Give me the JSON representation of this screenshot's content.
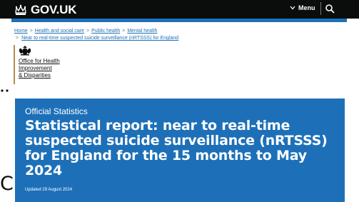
{
  "header": {
    "logo_text": "GOV.UK",
    "menu_label": "Menu",
    "colors": {
      "bar": "#0b0c0c",
      "accent": "#1d70b8"
    },
    "icons": [
      "crown-icon",
      "chevron-down-icon",
      "search-icon"
    ]
  },
  "breadcrumbs": {
    "items": [
      {
        "label": "Home"
      },
      {
        "label": "Health and social care"
      },
      {
        "label": "Public health"
      },
      {
        "label": "Mental health"
      },
      {
        "label": "Near to real-time suspected suicide surveillance (nRTSSS) for England"
      }
    ],
    "separator": ">"
  },
  "organisation": {
    "name_line1": "Office for Health",
    "name_line2": "Improvement",
    "name_line3": "& Disparities",
    "icon": "royal-crest-icon",
    "border_color": "#b18e49"
  },
  "hero": {
    "eyebrow": "Official Statistics",
    "title": "Statistical report: near to real-time suspected suicide surveillance (nRTSSS) for England for the 15 months to May 2024",
    "updated": "Updated 29 August 2024",
    "background": "#1d70b8"
  },
  "cut_off_text": "C"
}
